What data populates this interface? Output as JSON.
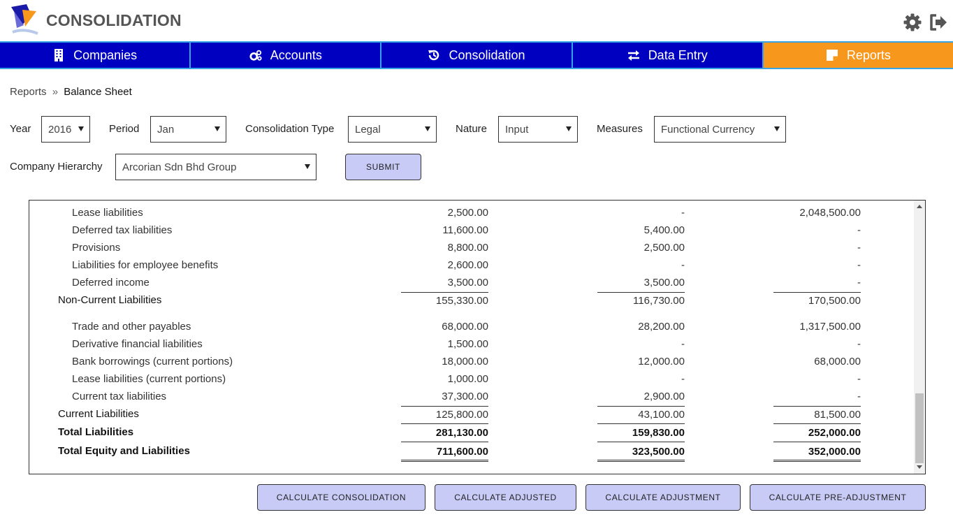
{
  "header": {
    "title": "CONSOLIDATION"
  },
  "nav": {
    "items": [
      {
        "label": "Companies",
        "icon": "building-icon"
      },
      {
        "label": "Accounts",
        "icon": "cogs-icon"
      },
      {
        "label": "Consolidation",
        "icon": "history-icon"
      },
      {
        "label": "Data Entry",
        "icon": "exchange-icon"
      },
      {
        "label": "Reports",
        "icon": "note-icon",
        "active": true
      }
    ]
  },
  "breadcrumb": {
    "parent": "Reports",
    "separator": "»",
    "current": "Balance Sheet"
  },
  "filters": {
    "year": {
      "label": "Year",
      "value": "2016"
    },
    "period": {
      "label": "Period",
      "value": "Jan"
    },
    "consolidation_type": {
      "label": "Consolidation Type",
      "value": "Legal"
    },
    "nature": {
      "label": "Nature",
      "value": "Input"
    },
    "measures": {
      "label": "Measures",
      "value": "Functional Currency"
    },
    "company_hierarchy": {
      "label": "Company Hierarchy",
      "value": "Arcorian Sdn Bhd Group"
    },
    "submit_label": "SUBMIT"
  },
  "report": {
    "rows": [
      {
        "label": "Lease liabilities",
        "c1": "2,500.00",
        "c2": "-",
        "c3": "2,048,500.00"
      },
      {
        "label": "Deferred tax liabilities",
        "c1": "11,600.00",
        "c2": "5,400.00",
        "c3": "-"
      },
      {
        "label": "Provisions",
        "c1": "8,800.00",
        "c2": "2,500.00",
        "c3": "-"
      },
      {
        "label": "Liabilities for employee benefits",
        "c1": "2,600.00",
        "c2": "-",
        "c3": "-"
      },
      {
        "label": "Deferred income",
        "c1": "3,500.00",
        "c2": "3,500.00",
        "c3": "-"
      },
      {
        "label": "Non-Current Liabilities",
        "c1": "155,330.00",
        "c2": "116,730.00",
        "c3": "170,500.00"
      },
      {
        "label": "Trade and other payables",
        "c1": "68,000.00",
        "c2": "28,200.00",
        "c3": "1,317,500.00"
      },
      {
        "label": "Derivative financial liabilities",
        "c1": "1,500.00",
        "c2": "-",
        "c3": "-"
      },
      {
        "label": "Bank borrowings (current portions)",
        "c1": "18,000.00",
        "c2": "12,000.00",
        "c3": "68,000.00"
      },
      {
        "label": "Lease liabilities (current portions)",
        "c1": "1,000.00",
        "c2": "-",
        "c3": "-"
      },
      {
        "label": "Current tax liabilities",
        "c1": "37,300.00",
        "c2": "2,900.00",
        "c3": "-"
      },
      {
        "label": "Current Liabilities",
        "c1": "125,800.00",
        "c2": "43,100.00",
        "c3": "81,500.00"
      },
      {
        "label": "Total Liabilities",
        "c1": "281,130.00",
        "c2": "159,830.00",
        "c3": "252,000.00"
      },
      {
        "label": "Total Equity and Liabilities",
        "c1": "711,600.00",
        "c2": "323,500.00",
        "c3": "352,000.00"
      }
    ]
  },
  "actions": {
    "calc_consolidation": "CALCULATE CONSOLIDATION",
    "calc_adjusted": "CALCULATE ADJUSTED",
    "calc_adjustment": "CALCULATE ADJUSTMENT",
    "calc_pre_adjustment": "CALCULATE PRE-ADJUSTMENT"
  },
  "colors": {
    "nav_bg": "#0000c0",
    "nav_active": "#f7981d",
    "nav_border": "#35a3e6",
    "button_bg": "#c9cbf7"
  }
}
